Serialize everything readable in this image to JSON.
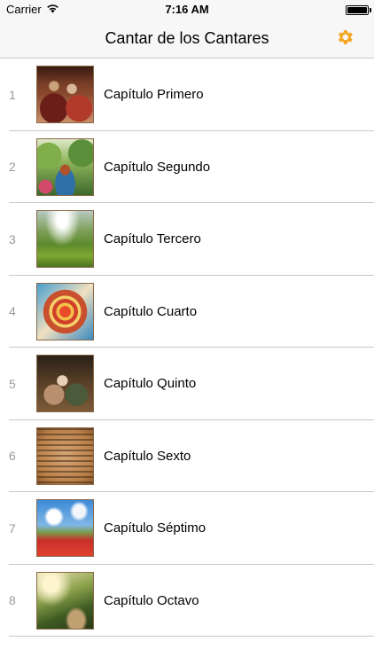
{
  "status_bar": {
    "carrier": "Carrier",
    "time": "7:16 AM",
    "battery_level": 1.0
  },
  "nav": {
    "title": "Cantar de los Cantares",
    "settings_icon": "gear-icon",
    "accent_color": "#f5a623"
  },
  "chapters": [
    {
      "number": "1",
      "label": "Capítulo Primero"
    },
    {
      "number": "2",
      "label": "Capítulo Segundo"
    },
    {
      "number": "3",
      "label": "Capítulo Tercero"
    },
    {
      "number": "4",
      "label": "Capítulo Cuarto"
    },
    {
      "number": "5",
      "label": "Capítulo Quinto"
    },
    {
      "number": "6",
      "label": "Capítulo Sexto"
    },
    {
      "number": "7",
      "label": "Capítulo Séptimo"
    },
    {
      "number": "8",
      "label": "Capítulo Octavo"
    }
  ]
}
